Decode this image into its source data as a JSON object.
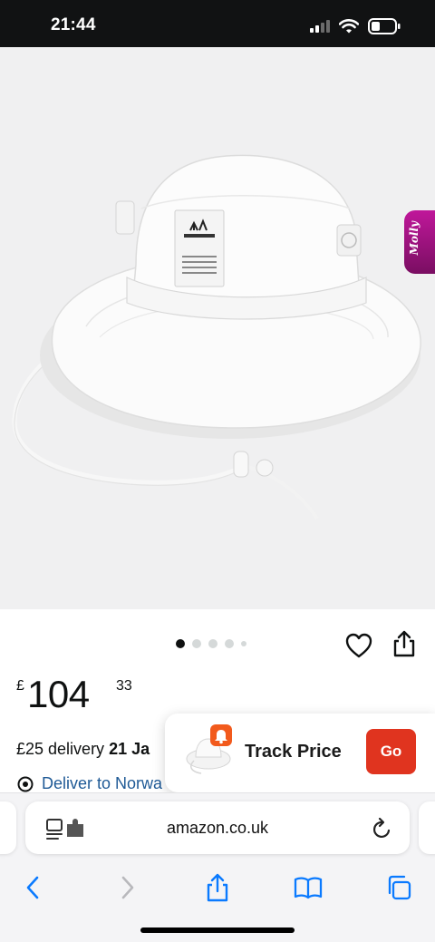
{
  "status_bar": {
    "time": "21:44",
    "battery_level": 0.3
  },
  "product": {
    "image_icon": "white-bucket-hat-image",
    "molly_tab_label": "Molly",
    "gallery": {
      "total_dots": 5,
      "active_index": 0
    },
    "wishlist_icon": "heart-icon",
    "share_icon": "share-icon",
    "price": {
      "currency": "£",
      "whole": "104",
      "fraction": "33"
    },
    "delivery": {
      "prefix": "£25 delivery",
      "date": "21 Ja"
    },
    "deliver_to": "Deliver to Norwa"
  },
  "track_price": {
    "label": "Track Price",
    "go_label": "Go",
    "badge_icon": "bell-icon",
    "accent": "#e0341f"
  },
  "browser": {
    "url": "amazon.co.uk",
    "page_settings_icon": "page-settings-icon",
    "reload_icon": "reload-icon",
    "toolbar": [
      "back-icon",
      "forward-icon",
      "share-icon",
      "bookmarks-icon",
      "tabs-icon"
    ],
    "accent": "#0a7aff"
  }
}
